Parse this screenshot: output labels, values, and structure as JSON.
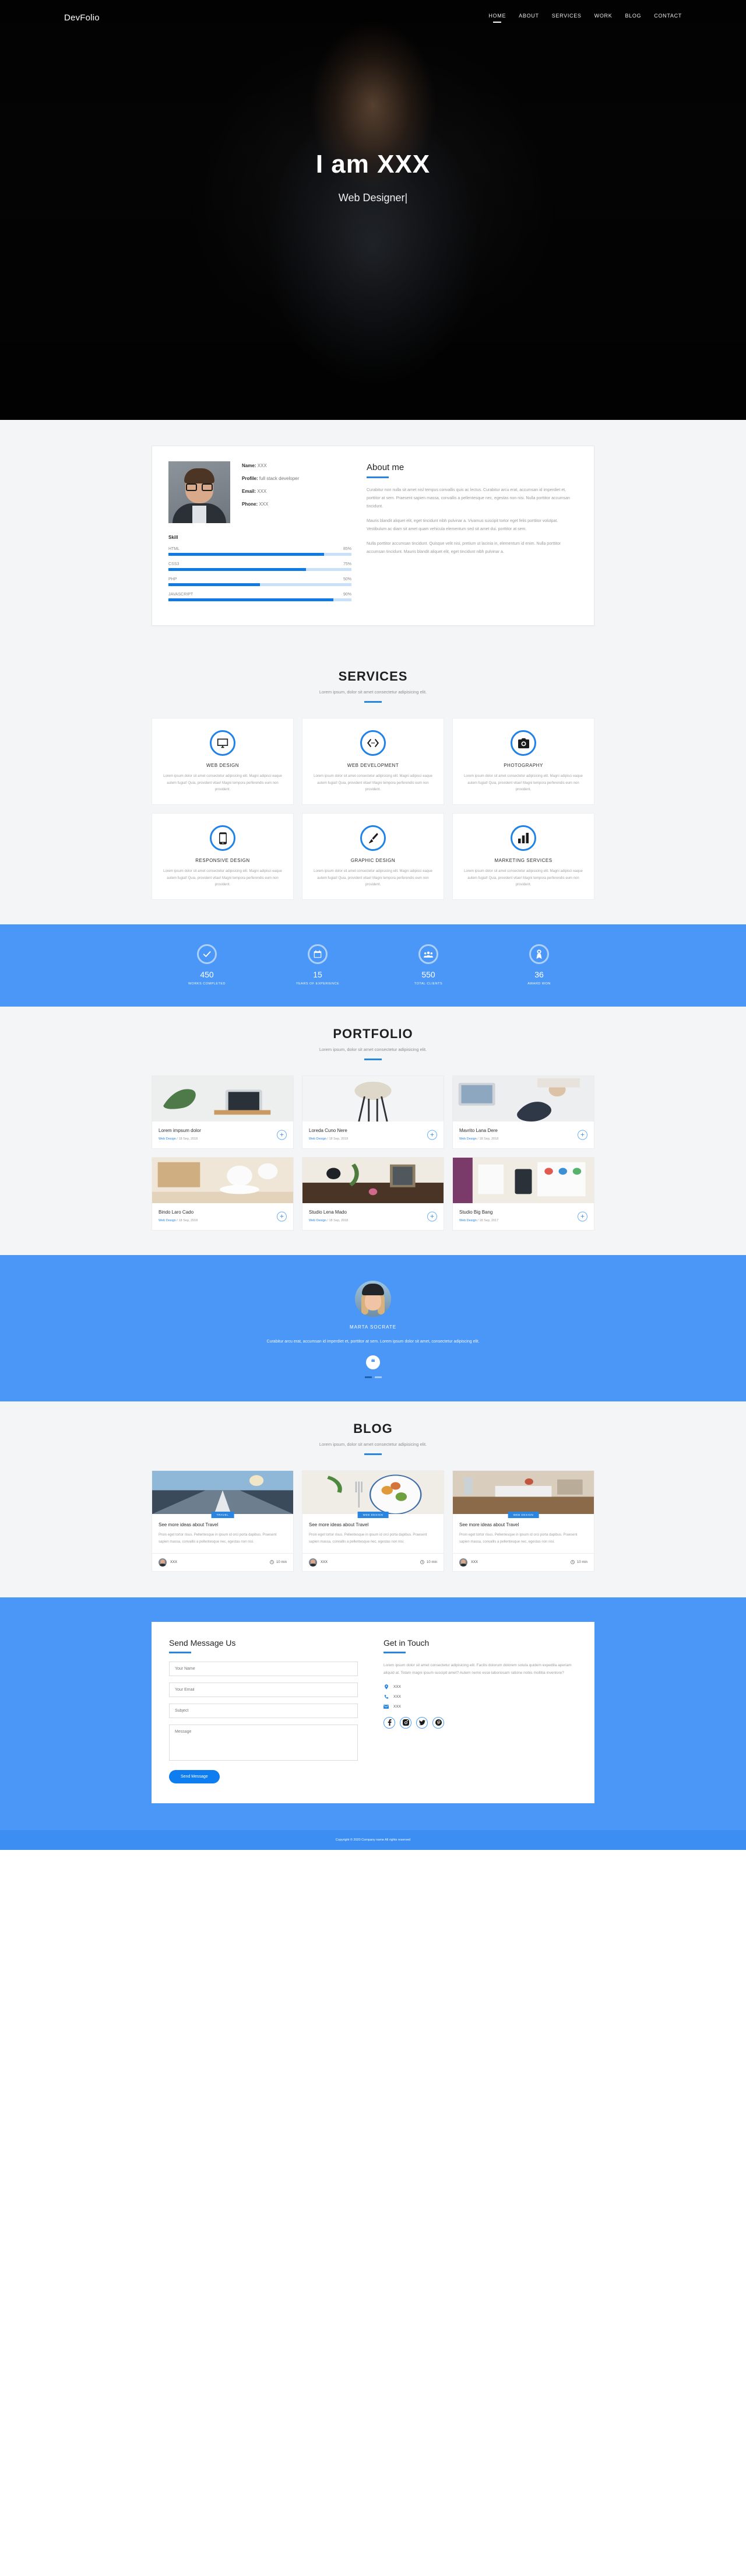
{
  "brand": "DevFolio",
  "nav": {
    "items": [
      {
        "label": "HOME",
        "active": true
      },
      {
        "label": "ABOUT",
        "active": false
      },
      {
        "label": "SERVICES",
        "active": false
      },
      {
        "label": "WORK",
        "active": false
      },
      {
        "label": "BLOG",
        "active": false
      },
      {
        "label": "CONTACT",
        "active": false
      }
    ]
  },
  "hero": {
    "title": "I am XXX",
    "subtitle": "Web Designer|"
  },
  "about": {
    "info": [
      {
        "label": "Name:",
        "value": "XXX"
      },
      {
        "label": "Profile:",
        "value": "full stack developer"
      },
      {
        "label": "Email:",
        "value": "XXX"
      },
      {
        "label": "Phone:",
        "value": "XXX"
      }
    ],
    "skill_heading": "Skill",
    "skills": [
      {
        "name": "HTML",
        "percent": "85%",
        "value": 85
      },
      {
        "name": "CSS3",
        "percent": "75%",
        "value": 75
      },
      {
        "name": "PHP",
        "percent": "50%",
        "value": 50
      },
      {
        "name": "JAVASCRIPT",
        "percent": "90%",
        "value": 90
      }
    ],
    "heading": "About me",
    "paragraphs": [
      "Curabitur non nulla sit amet nisl tempus convallis quis ac lectus. Curabitur arcu erat, accumsan id imperdiet et, porttitor at sem. Praesent sapien massa, convallis a pellentesque nec, egestas non nisi. Nulla porttitor accumsan tincidunt.",
      "Mauris blandit aliquet elit, eget tincidunt nibh pulvinar a. Vivamus suscipit tortor eget felis porttitor volutpat. Vestibulum ac diam sit amet quam vehicula elementum sed sit amet dui. porttitor at sem.",
      "Nulla porttitor accumsan tincidunt. Quisque velit nisi, pretium ut lacinia in, elementum id enim. Nulla porttitor accumsan tincidunt. Mauris blandit aliquet elit, eget tincidunt nibh pulvinar a."
    ]
  },
  "services": {
    "title": "SERVICES",
    "subtitle": "Lorem ipsum, dolor sit amet consectetur adipisicing elit.",
    "items": [
      {
        "icon": "monitor-icon",
        "name": "WEB DESIGN",
        "text": "Lorem ipsum dolor sit amet consectetur adipisicing elit. Magni adipisci eaque autem fugiat! Quia, provident vitae! Magni tempora perferendis eum non provident."
      },
      {
        "icon": "code-icon",
        "name": "WEB DEVELOPMENT",
        "text": "Lorem ipsum dolor sit amet consectetur adipisicing elit. Magni adipisci eaque autem fugiat! Quia, provident vitae! Magni tempora perferendis eum non provident."
      },
      {
        "icon": "camera-icon",
        "name": "PHOTOGRAPHY",
        "text": "Lorem ipsum dolor sit amet consectetur adipisicing elit. Magni adipisci eaque autem fugiat! Quia, provident vitae! Magni tempora perferendis eum non provident."
      },
      {
        "icon": "mobile-icon",
        "name": "RESPONSIVE DESIGN",
        "text": "Lorem ipsum dolor sit amet consectetur adipisicing elit. Magni adipisci eaque autem fugiat! Quia, provident vitae! Magni tempora perferendis eum non provident."
      },
      {
        "icon": "brush-icon",
        "name": "GRAPHIC DESIGN",
        "text": "Lorem ipsum dolor sit amet consectetur adipisicing elit. Magni adipisci eaque autem fugiat! Quia, provident vitae! Magni tempora perferendis eum non provident."
      },
      {
        "icon": "chart-bar-icon",
        "name": "MARKETING SERVICES",
        "text": "Lorem ipsum dolor sit amet consectetur adipisicing elit. Magni adipisci eaque autem fugiat! Quia, provident vitae! Magni tempora perferendis eum non provident."
      }
    ]
  },
  "stats": {
    "items": [
      {
        "icon": "check-circle-icon",
        "number": "450",
        "label": "WORKS COMPLETED"
      },
      {
        "icon": "calendar-icon",
        "number": "15",
        "label": "YEARS OF EXPERIENCE"
      },
      {
        "icon": "users-icon",
        "number": "550",
        "label": "TOTAL CLIENTS"
      },
      {
        "icon": "award-icon",
        "number": "36",
        "label": "AWARD WON"
      }
    ]
  },
  "portfolio": {
    "title": "PORTFOLIO",
    "subtitle": "Lorem ipsum, dolor sit amet consectetur adipisicing elit.",
    "items": [
      {
        "title": "Lorem impsum dolor",
        "category": "Web Design",
        "date": "18 Sep, 2018"
      },
      {
        "title": "Loreda Cuno Nere",
        "category": "Web Design",
        "date": "18 Sep, 2018"
      },
      {
        "title": "Mavrito Lana Dere",
        "category": "Web Design",
        "date": "18 Sep, 2018"
      },
      {
        "title": "Bindo Laro Cado",
        "category": "Web Design",
        "date": "18 Sep, 2018"
      },
      {
        "title": "Studio Lena Mado",
        "category": "Web Design",
        "date": "18 Sep, 2018"
      },
      {
        "title": "Studio Big Bang",
        "category": "Web Design",
        "date": "18 Sep, 2017"
      }
    ]
  },
  "testimonial": {
    "name": "MARTA SOCRATE",
    "text": "Curabitur arcu erat, accumsan id imperdiet et, porttitor at sem. Lorem ipsum dolor sit amet, consectetur adipiscing elit.",
    "quote_icon": "quote-icon"
  },
  "blog": {
    "title": "BLOG",
    "subtitle": "Lorem ipsum, dolor sit amet consectetur adipisicing elit.",
    "posts": [
      {
        "badge": "TRAVEL",
        "title": "See more ideas about Travel",
        "text": "Proin eget tortor risus. Pellentesque in ipsum id orci porta dapibus. Praesent sapien massa, convallis a pellentesque nec, egestas non nisi.",
        "author": "XXX",
        "read_time": "10 min"
      },
      {
        "badge": "WEB DESIGN",
        "title": "See more ideas about Travel",
        "text": "Proin eget tortor risus. Pellentesque in ipsum id orci porta dapibus. Praesent sapien massa, convallis a pellentesque nec, egestas non nisi.",
        "author": "XXX",
        "read_time": "10 min"
      },
      {
        "badge": "WEB DESIGN",
        "title": "See more ideas about Travel",
        "text": "Proin eget tortor risus. Pellentesque in ipsum id orci porta dapibus. Praesent sapien massa, convallis a pellentesque nec, egestas non nisi.",
        "author": "XXX",
        "read_time": "10 min"
      }
    ]
  },
  "contact": {
    "form_heading": "Send Message Us",
    "fields": {
      "name_placeholder": "Your Name",
      "email_placeholder": "Your Email",
      "subject_placeholder": "Subject",
      "message_placeholder": "Message"
    },
    "submit_label": "Send Message",
    "touch_heading": "Get in Touch",
    "touch_text": "Lorem ipsum dolor sit amet consectetur adipisicing elit. Facilis dolorum dolorem soluta quidem expedita aperiam aliquid at. Totam magni ipsum suscipit amet? Autem nemo esse laboriosam ratione nobis mollitia inventore?",
    "details": [
      {
        "icon": "map-pin-icon",
        "value": "XXX"
      },
      {
        "icon": "phone-icon",
        "value": "XXX"
      },
      {
        "icon": "mail-icon",
        "value": "XXX"
      }
    ],
    "socials": [
      "facebook-icon",
      "instagram-icon",
      "twitter-icon",
      "pinterest-icon"
    ]
  },
  "footer": {
    "text": "Copyright © 2020 Company name All rights reserved"
  },
  "colors": {
    "accent": "#2a85e0",
    "accent_bg": "#4a97f7",
    "page_bg": "#f4f5f7"
  }
}
